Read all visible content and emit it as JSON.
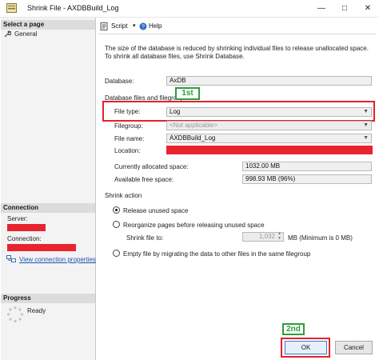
{
  "window": {
    "title": "Shrink File - AXDBBuild_Log",
    "minimize_label": "—",
    "maximize_label": "□",
    "close_label": "✕"
  },
  "left_pane": {
    "select_page_header": "Select a page",
    "pages": [
      {
        "label": "General"
      }
    ],
    "connection_header": "Connection",
    "server_label": "Server:",
    "connection_label": "Connection:",
    "view_connection_link": "View connection properties",
    "progress_header": "Progress",
    "progress_status": "Ready"
  },
  "toolbar": {
    "script_label": "Script",
    "help_label": "Help"
  },
  "form": {
    "description": "The size of the database is reduced by shrinking individual files to release unallocated space. To shrink all database files, use Shrink Database.",
    "database_label": "Database:",
    "database_value": "AxDB",
    "files_group_label": "Database files and filegroups",
    "file_type_label": "File type:",
    "file_type_value": "Log",
    "filegroup_label": "Filegroup:",
    "filegroup_value": "<Not applicable>",
    "file_name_label": "File name:",
    "file_name_value": "AXDBBuild_Log",
    "location_label": "Location:",
    "allocated_label": "Currently allocated space:",
    "allocated_value": "1032.00 MB",
    "free_label": "Available free space:",
    "free_value": "998.93 MB (96%)",
    "shrink_action_label": "Shrink action",
    "release_label": "Release unused space",
    "reorganize_label": "Reorganize pages before releasing unused space",
    "shrink_to_label": "Shrink file to:",
    "shrink_to_value": "1,032",
    "shrink_to_unit": "MB (Minimum is 0 MB)",
    "empty_label": "Empty file by migrating the data to other files in the same filegroup"
  },
  "annotations": {
    "first": "1st",
    "second": "2nd"
  },
  "buttons": {
    "ok_label": "OK",
    "cancel_label": "Cancel"
  },
  "colors": {
    "callout_red": "#e0232b",
    "badge_green": "#2d9c3e",
    "redaction": "#e8242f",
    "link_blue": "#1a56b0"
  }
}
